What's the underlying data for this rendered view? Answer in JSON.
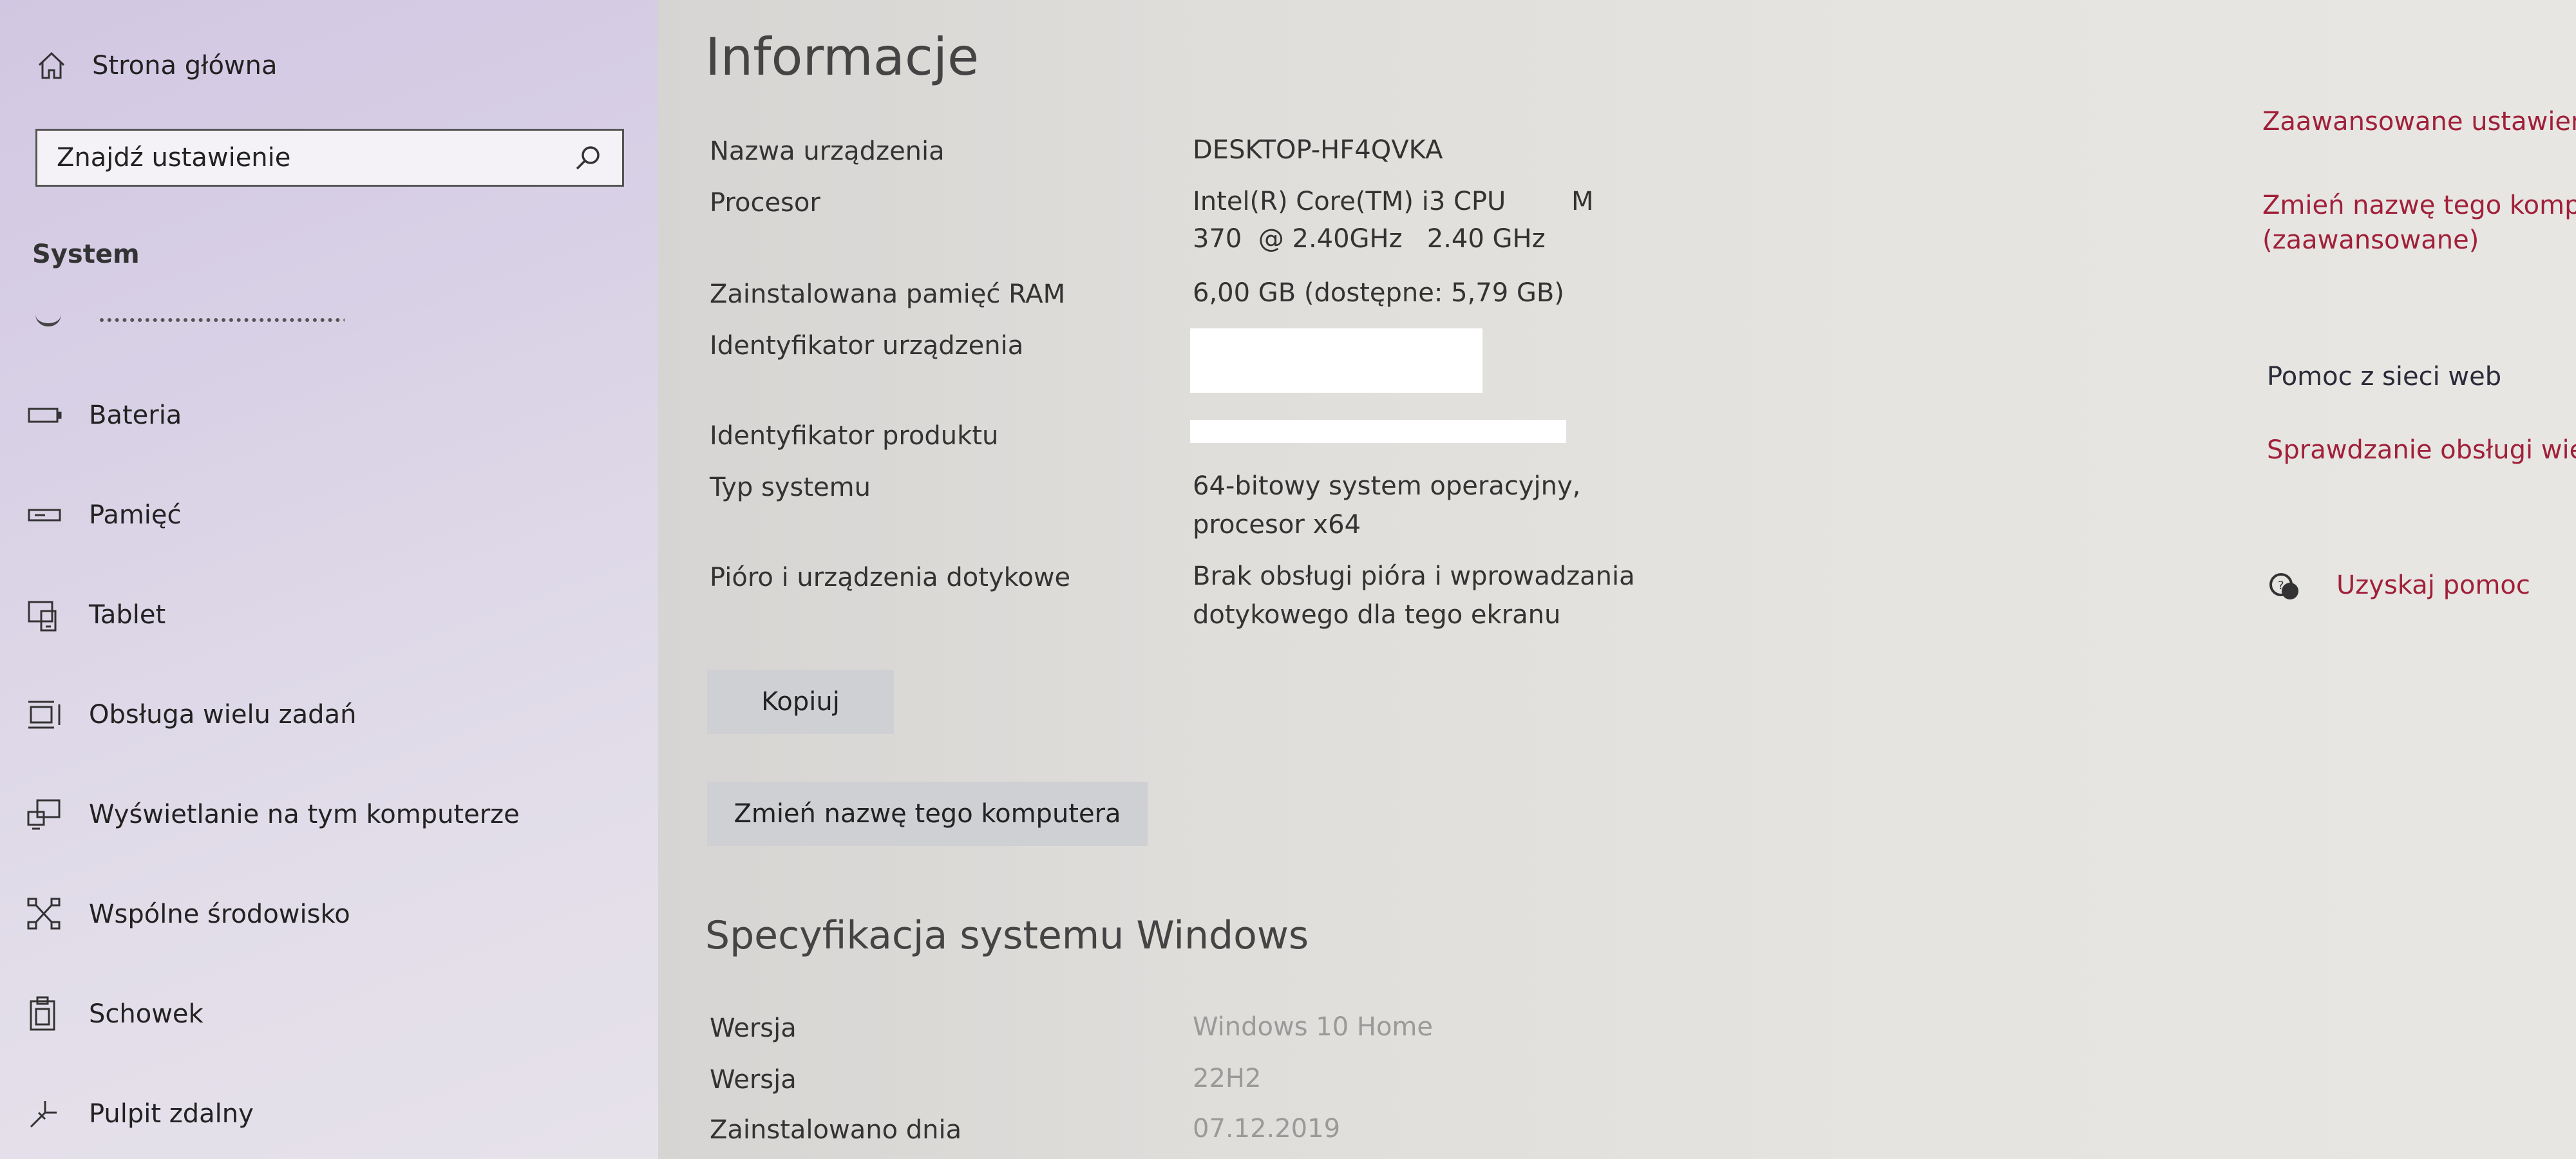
{
  "sidebar": {
    "home_label": "Strona główna",
    "search_placeholder": "Znajdź ustawienie",
    "section_title": "System",
    "items": [
      {
        "label": "Bateria",
        "icon": "battery-icon"
      },
      {
        "label": "Pamięć",
        "icon": "storage-icon"
      },
      {
        "label": "Tablet",
        "icon": "tablet-icon"
      },
      {
        "label": "Obsługa wielu zadań",
        "icon": "multitasking-icon"
      },
      {
        "label": "Wyświetlanie na tym komputerze",
        "icon": "projecting-icon"
      },
      {
        "label": "Wspólne środowisko",
        "icon": "shared-experiences-icon"
      },
      {
        "label": "Schowek",
        "icon": "clipboard-icon"
      },
      {
        "label": "Pulpit zdalny",
        "icon": "remote-desktop-icon"
      }
    ]
  },
  "main": {
    "title": "Informacje",
    "specs": [
      {
        "label": "Nazwa urządzenia",
        "value": "DESKTOP-HF4QVKA"
      },
      {
        "label": "Procesor",
        "value_line1": "Intel(R) Core(TM) i3 CPU        M",
        "value_line2": "370  @ 2.40GHz   2.40 GHz"
      },
      {
        "label": "Zainstalowana pamięć RAM",
        "value": "6,00 GB (dostępne: 5,79 GB)"
      },
      {
        "label": "Identyfikator urządzenia",
        "value": ""
      },
      {
        "label": "Identyfikator produktu",
        "value": ""
      },
      {
        "label": "Typ systemu",
        "value_line1": "64-bitowy system operacyjny,",
        "value_line2": "procesor x64"
      },
      {
        "label": "Pióro i urządzenia dotykowe",
        "value_line1": "Brak obsługi pióra i wprowadzania",
        "value_line2": "dotykowego dla tego ekranu"
      }
    ],
    "copy_button": "Kopiuj",
    "rename_button": "Zmień nazwę tego komputera",
    "windows_spec_title": "Specyfikacja systemu Windows",
    "windows_specs": [
      {
        "label": "Wersja",
        "value": "Windows 10 Home"
      },
      {
        "label": "Wersja",
        "value": "22H2"
      },
      {
        "label": "Zainstalowano dnia",
        "value": "07.12.2019"
      }
    ]
  },
  "related": {
    "advanced_link": "Zaawansowane ustawieni",
    "rename_advanced_line1": "Zmień nazwę tego komp",
    "rename_advanced_line2": "(zaawansowane)",
    "web_help_title": "Pomoc z sieci web",
    "check_support_link": "Sprawdzanie obsługi wie",
    "get_help_link": "Uzyskaj pomoc"
  },
  "colors": {
    "link": "#a0203a",
    "sidebar": "#d9d2e6",
    "button": "#cfd0d3"
  }
}
